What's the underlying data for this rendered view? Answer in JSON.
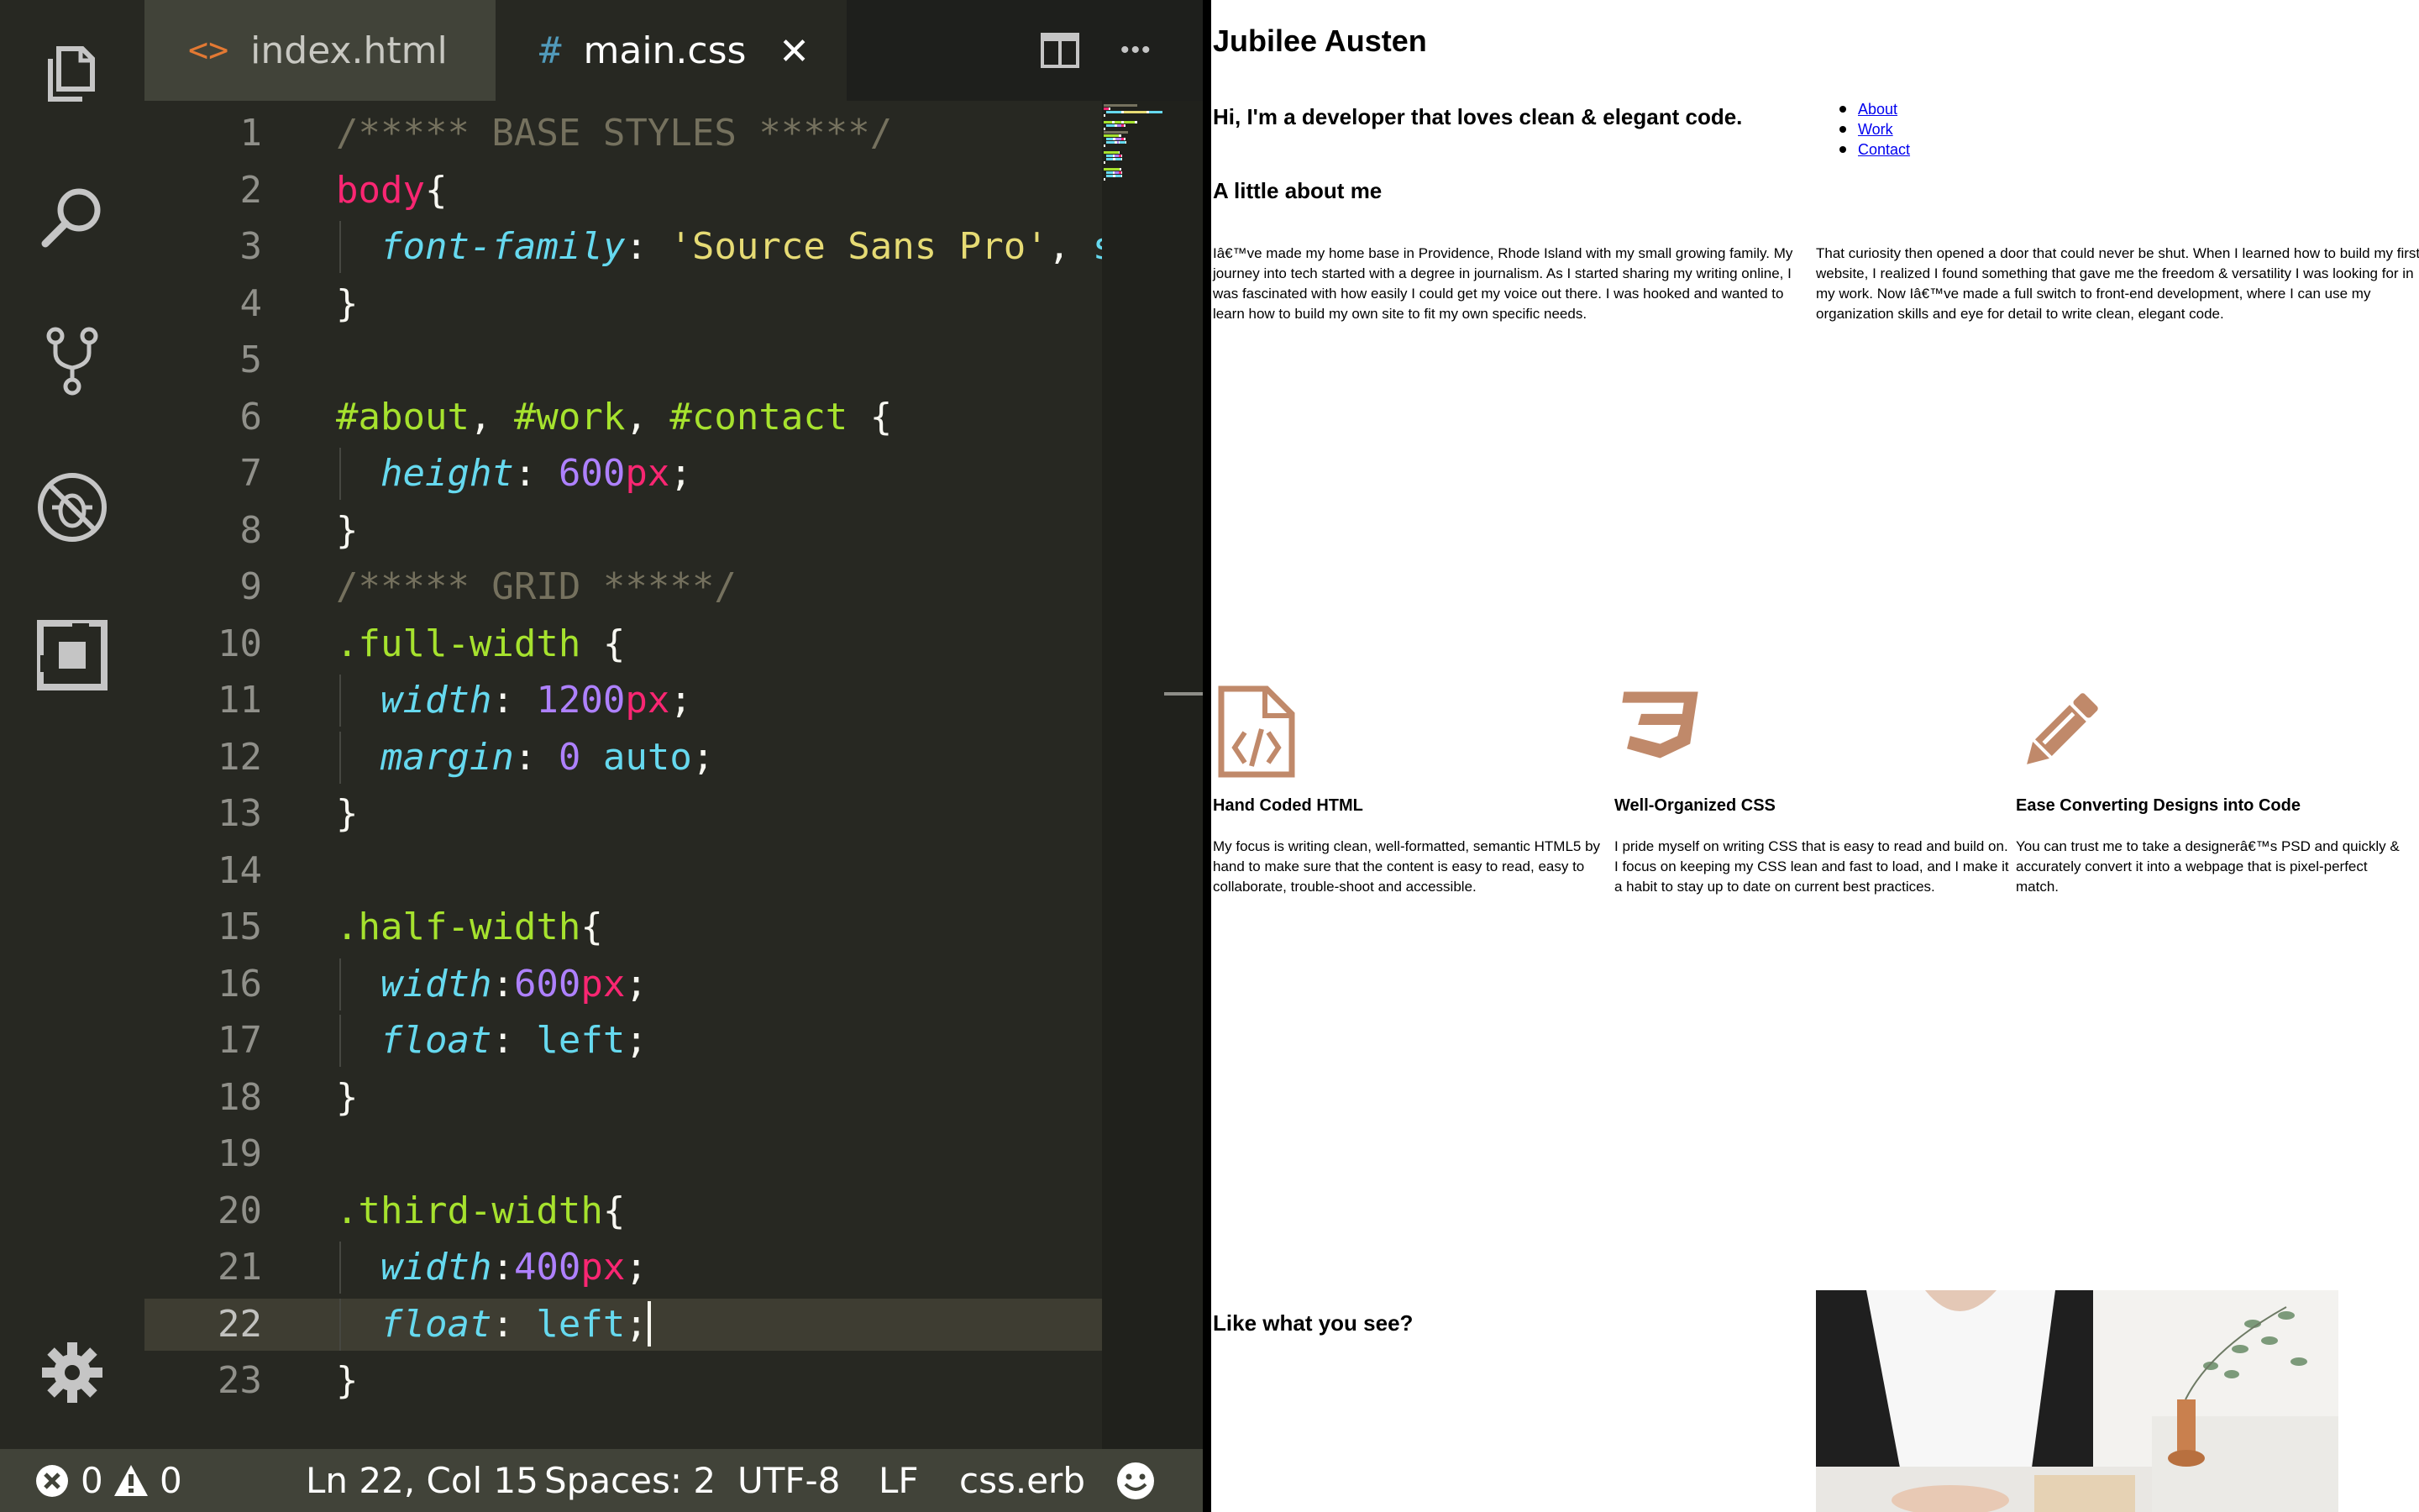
{
  "editor": {
    "tabs": [
      {
        "label": "index.html",
        "glyph": "<>"
      },
      {
        "label": "main.css",
        "glyph": "#",
        "close": "✕"
      }
    ],
    "more_actions": "•••",
    "code_lines": [
      {
        "n": "1",
        "tokens": [
          [
            "c",
            "/***** BASE STYLES *****/"
          ]
        ]
      },
      {
        "n": "2",
        "tokens": [
          [
            "t",
            "body"
          ],
          [
            "p",
            "{"
          ]
        ]
      },
      {
        "n": "3",
        "indent": true,
        "tokens": [
          [
            "s",
            "  "
          ],
          [
            "k",
            "font-family"
          ],
          [
            "p",
            ": "
          ],
          [
            "str",
            "'Source Sans Pro'"
          ],
          [
            "p",
            ", "
          ],
          [
            "kw",
            "sans-serif"
          ]
        ]
      },
      {
        "n": "4",
        "tokens": [
          [
            "p",
            "}"
          ]
        ]
      },
      {
        "n": "5",
        "tokens": []
      },
      {
        "n": "6",
        "tokens": [
          [
            "id",
            "#about"
          ],
          [
            "p",
            ", "
          ],
          [
            "id",
            "#work"
          ],
          [
            "p",
            ", "
          ],
          [
            "id",
            "#contact"
          ],
          [
            "p",
            " {"
          ]
        ]
      },
      {
        "n": "7",
        "indent": true,
        "tokens": [
          [
            "s",
            "  "
          ],
          [
            "k",
            "height"
          ],
          [
            "p",
            ": "
          ],
          [
            "num",
            "600"
          ],
          [
            "u",
            "px"
          ],
          [
            "p",
            ";"
          ]
        ]
      },
      {
        "n": "8",
        "tokens": [
          [
            "p",
            "}"
          ]
        ]
      },
      {
        "n": "9",
        "tokens": [
          [
            "c",
            "/***** GRID *****/"
          ]
        ]
      },
      {
        "n": "10",
        "tokens": [
          [
            "id",
            ".full-width"
          ],
          [
            "p",
            " {"
          ]
        ]
      },
      {
        "n": "11",
        "indent": true,
        "tokens": [
          [
            "s",
            "  "
          ],
          [
            "k",
            "width"
          ],
          [
            "p",
            ": "
          ],
          [
            "num",
            "1200"
          ],
          [
            "u",
            "px"
          ],
          [
            "p",
            ";"
          ]
        ]
      },
      {
        "n": "12",
        "indent": true,
        "tokens": [
          [
            "s",
            "  "
          ],
          [
            "k",
            "margin"
          ],
          [
            "p",
            ": "
          ],
          [
            "num",
            "0"
          ],
          [
            "p",
            " "
          ],
          [
            "kw",
            "auto"
          ],
          [
            "p",
            ";"
          ]
        ]
      },
      {
        "n": "13",
        "tokens": [
          [
            "p",
            "}"
          ]
        ]
      },
      {
        "n": "14",
        "tokens": []
      },
      {
        "n": "15",
        "tokens": [
          [
            "id",
            ".half-width"
          ],
          [
            "p",
            "{"
          ]
        ]
      },
      {
        "n": "16",
        "indent": true,
        "tokens": [
          [
            "s",
            "  "
          ],
          [
            "k",
            "width"
          ],
          [
            "p",
            ":"
          ],
          [
            "num",
            "600"
          ],
          [
            "u",
            "px"
          ],
          [
            "p",
            ";"
          ]
        ]
      },
      {
        "n": "17",
        "indent": true,
        "tokens": [
          [
            "s",
            "  "
          ],
          [
            "k",
            "float"
          ],
          [
            "p",
            ": "
          ],
          [
            "kw",
            "left"
          ],
          [
            "p",
            ";"
          ]
        ]
      },
      {
        "n": "18",
        "tokens": [
          [
            "p",
            "}"
          ]
        ]
      },
      {
        "n": "19",
        "tokens": []
      },
      {
        "n": "20",
        "tokens": [
          [
            "id",
            ".third-width"
          ],
          [
            "p",
            "{"
          ]
        ]
      },
      {
        "n": "21",
        "indent": true,
        "tokens": [
          [
            "s",
            "  "
          ],
          [
            "k",
            "width"
          ],
          [
            "p",
            ":"
          ],
          [
            "num",
            "400"
          ],
          [
            "u",
            "px"
          ],
          [
            "p",
            ";"
          ]
        ]
      },
      {
        "n": "22",
        "indent": true,
        "current": true,
        "tokens": [
          [
            "s",
            "  "
          ],
          [
            "k",
            "float"
          ],
          [
            "p",
            ": "
          ],
          [
            "kw",
            "left"
          ],
          [
            "p",
            ";"
          ],
          [
            "cursor",
            ""
          ]
        ]
      },
      {
        "n": "23",
        "tokens": [
          [
            "p",
            "}"
          ]
        ]
      }
    ],
    "status": {
      "errors": "0",
      "warnings": "0",
      "position": "Ln 22, Col 15",
      "spaces": "Spaces: 2",
      "encoding": "UTF-8",
      "eol": "LF",
      "language": "css.erb"
    },
    "colors": {
      "background": "#272822",
      "comment": "#75715e",
      "tag": "#f92672",
      "property": "#66d9ef",
      "string": "#e6db74",
      "selector": "#a6e22e",
      "number": "#ae81ff"
    }
  },
  "preview": {
    "name": "Jubilee Austen",
    "hero": "Hi, I'm a developer that loves clean & elegant code.",
    "nav": [
      "About",
      "Work",
      "Contact"
    ],
    "about_title": "A little about me",
    "about_p1": "Iâ€™ve made my home base in Providence, Rhode Island with my small growing family. My journey into tech started with a degree in journalism. As I started sharing my writing online, I was fascinated with how easily I could get my voice out there. I was hooked and wanted to learn how to build my own site to fit my own specific needs.",
    "about_p2": "That curiosity then opened a door that could never be shut. When I learned how to build my first website, I realized I found something that gave me the freedom & versatility I was looking for in my work. Now Iâ€™ve made a full switch to front-end development, where I can use my organization skills and eye for detail to write clean, elegant code.",
    "skills": [
      {
        "icon": "file-code-icon",
        "title": "Hand Coded HTML",
        "text": "My focus is writing clean, well-formatted, semantic HTML5 by hand to make sure that the content is easy to read, easy to collaborate, trouble-shoot and accessible."
      },
      {
        "icon": "css3-icon",
        "title": "Well-Organized CSS",
        "text": "I pride myself on writing CSS that is easy to read and build on. I focus on keeping my CSS lean and fast to load, and I make it a habit to stay up to date on current best practices."
      },
      {
        "icon": "pencil-icon",
        "title": "Ease Converting Designs into Code",
        "text": "You can trust me to take a designerâ€™s PSD and quickly & accurately convert it into a webpage that is pixel-perfect match."
      }
    ],
    "icon_color": "#c0896a",
    "contact_title": "Like what you see?"
  }
}
